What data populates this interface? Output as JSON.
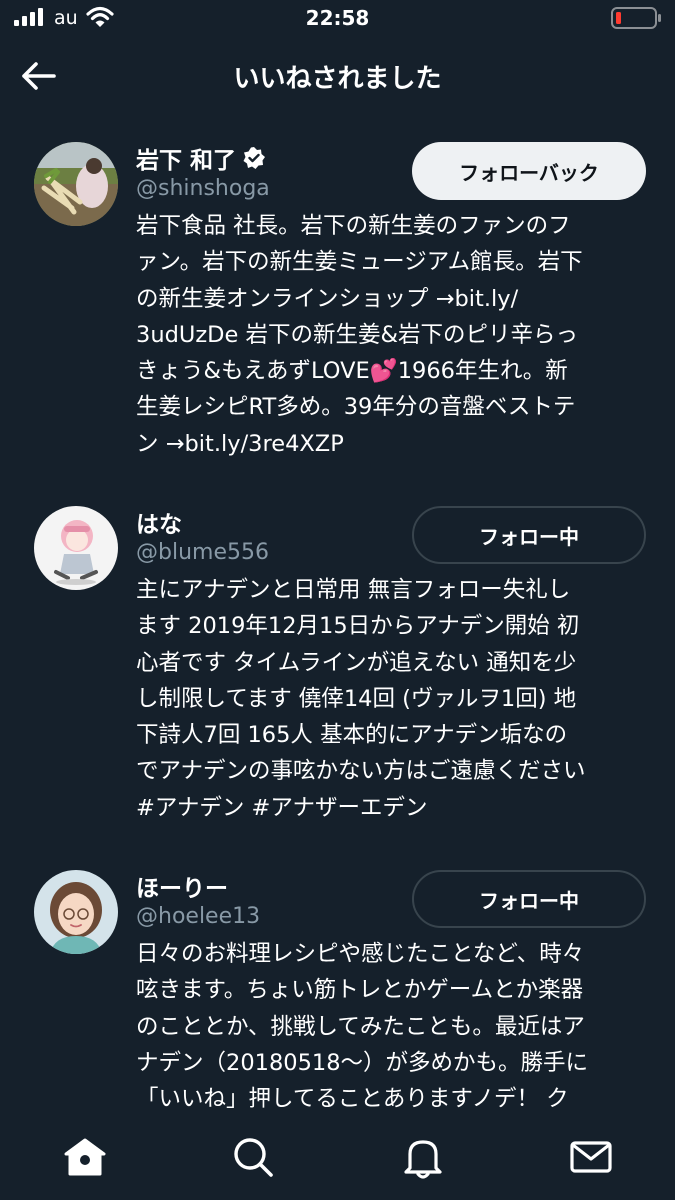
{
  "status_bar": {
    "carrier": "au",
    "time": "22:58"
  },
  "header": {
    "title": "いいねされました"
  },
  "users": [
    {
      "display_name": "岩下 和了",
      "handle": "@shinshoga",
      "verified": true,
      "follow_label": "フォローバック",
      "bio_lines": [
        "岩下食品 社長。岩下の新生姜のファンのフ",
        "ァン。岩下の新生姜ミュージアム館長。岩下",
        "の新生姜オンラインショップ →bit.ly/",
        "3udUzDe 岩下の新生姜&岩下のピリ辛らっ",
        "きょう&もえあずLOVE💕1966年生れ。新",
        "生姜レシピRT多め。39年分の音盤ベストテ",
        "ン →bit.ly/3re4XZP"
      ]
    },
    {
      "display_name": "はな",
      "handle": "@blume556",
      "verified": false,
      "follow_label": "フォロー中",
      "bio_lines": [
        "主にアナデンと日常用 無言フォロー失礼し",
        "ます 2019年12月15日からアナデン開始 初",
        "心者です タイムラインが追えない 通知を少",
        "し制限してます 僥倖14回 (ヴァルヲ1回) 地",
        "下詩人7回 165人 基本的にアナデン垢なの",
        "でアナデンの事呟かない方はご遠慮ください",
        "#アナデン #アナザーエデン"
      ]
    },
    {
      "display_name": "ほーりー",
      "handle": "@hoelee13",
      "verified": false,
      "follow_label": "フォロー中",
      "bio_lines": [
        "日々のお料理レシピや感じたことなど、時々",
        "呟きます。ちょい筋トレとかゲームとか楽器",
        "のこととか、挑戦してみたことも。最近はア",
        "ナデン（20180518～）が多めかも。勝手に",
        "「いいね」押してることありますノデ！ ク"
      ]
    }
  ],
  "tab_bar": {
    "items": [
      "home-icon",
      "search-icon",
      "notifications-icon",
      "messages-icon"
    ]
  },
  "colors": {
    "background": "#15202b",
    "secondary_text": "#8899a6",
    "button_light": "#eef1f3",
    "border": "#38444d",
    "battery_low": "#ff3b30"
  }
}
